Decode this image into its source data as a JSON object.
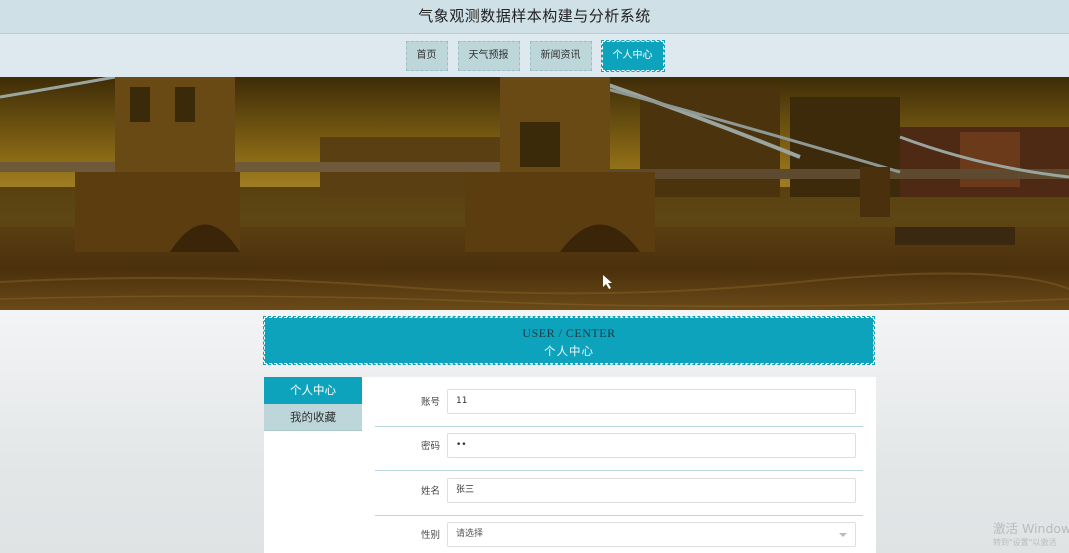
{
  "header": {
    "title": "气象观测数据样本构建与分析系统"
  },
  "nav": {
    "items": [
      {
        "label": "首页",
        "active": false
      },
      {
        "label": "天气预报",
        "active": false
      },
      {
        "label": "新闻资讯",
        "active": false
      },
      {
        "label": "个人中心",
        "active": true
      }
    ]
  },
  "banner": {
    "icon": "tower-bridge-photo"
  },
  "center_header": {
    "en": "USER / CENTER",
    "cn": "个人中心"
  },
  "side_menu": {
    "items": [
      {
        "label": "个人中心",
        "active": true
      },
      {
        "label": "我的收藏",
        "active": false
      }
    ]
  },
  "form": {
    "account": {
      "label": "账号",
      "value": "11"
    },
    "password": {
      "label": "密码",
      "value": "••"
    },
    "name": {
      "label": "姓名",
      "value": "张三"
    },
    "gender": {
      "label": "性别",
      "selected": "请选择"
    }
  },
  "watermark": {
    "line1": "激活 Windows",
    "line2": "转到\"设置\"以激活"
  },
  "colors": {
    "accent": "#0ea3bd",
    "nav_bg": "#bcd6da",
    "header_bg": "#cfe0e6"
  }
}
